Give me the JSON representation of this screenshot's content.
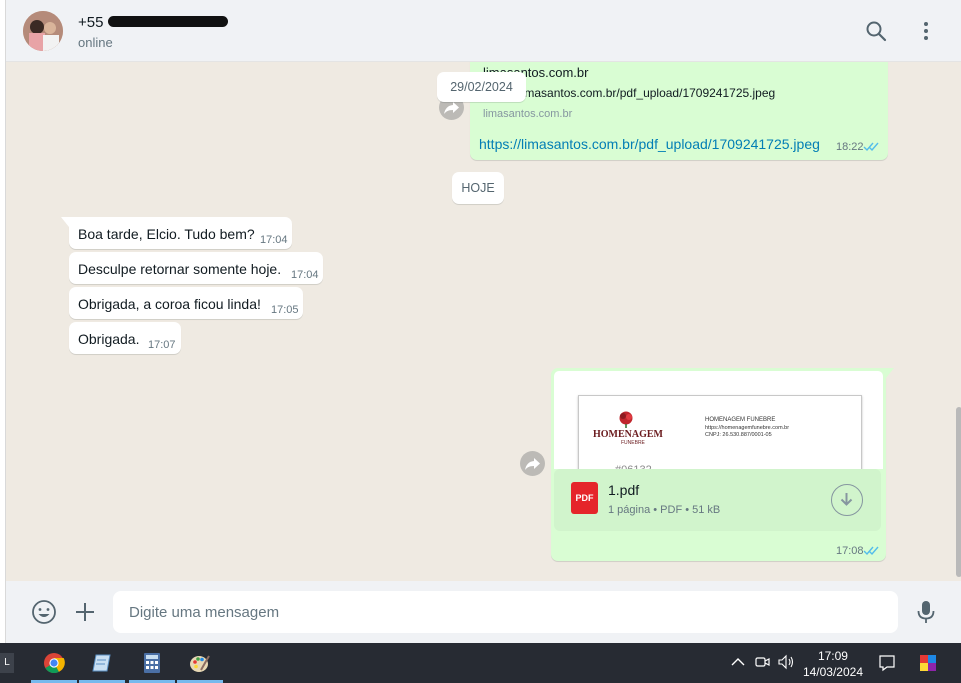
{
  "header": {
    "contact_name": "+55",
    "contact_status": "online"
  },
  "chat": {
    "link_message": {
      "preview_title": "limasantos.com.br",
      "preview_url": "https://limasantos.com.br/pdf_upload/1709241725.jpeg",
      "preview_domain": "limasantos.com.br",
      "link_text": "https://limasantos.com.br/pdf_upload/1709241725.jpeg",
      "time": "18:22"
    },
    "date_chip": "29/02/2024",
    "today_chip": "HOJE",
    "incoming": [
      {
        "text": "Boa tarde, Elcio. Tudo bem?",
        "time": "17:04"
      },
      {
        "text": "Desculpe retornar somente hoje.",
        "time": "17:04"
      },
      {
        "text": "Obrigada, a coroa ficou linda!",
        "time": "17:05"
      },
      {
        "text": "Obrigada.",
        "time": "17:07"
      }
    ],
    "document": {
      "preview_logo": "HOMENAGEM",
      "preview_logo_sub": "FUNEBRE",
      "preview_company": "HOMENAGEM FUNEBRE",
      "preview_site": "https://homenagemfunebre.com.br",
      "preview_cnpj": "CNPJ: 26.530.887/0001-05",
      "preview_number": "#06132",
      "icon_label": "PDF",
      "filename": "1.pdf",
      "meta": "1 página • PDF • 51 kB",
      "time": "17:08"
    }
  },
  "footer": {
    "placeholder": "Digite uma mensagem"
  },
  "taskbar": {
    "clock_time": "17:09",
    "clock_date": "14/03/2024",
    "left_label": "L"
  },
  "colors": {
    "outgoing_bubble": "#d9fdd3",
    "incoming_bubble": "#ffffff",
    "link": "#027eb5",
    "read_ticks": "#53bdeb",
    "pdf_red": "#e5252a"
  }
}
